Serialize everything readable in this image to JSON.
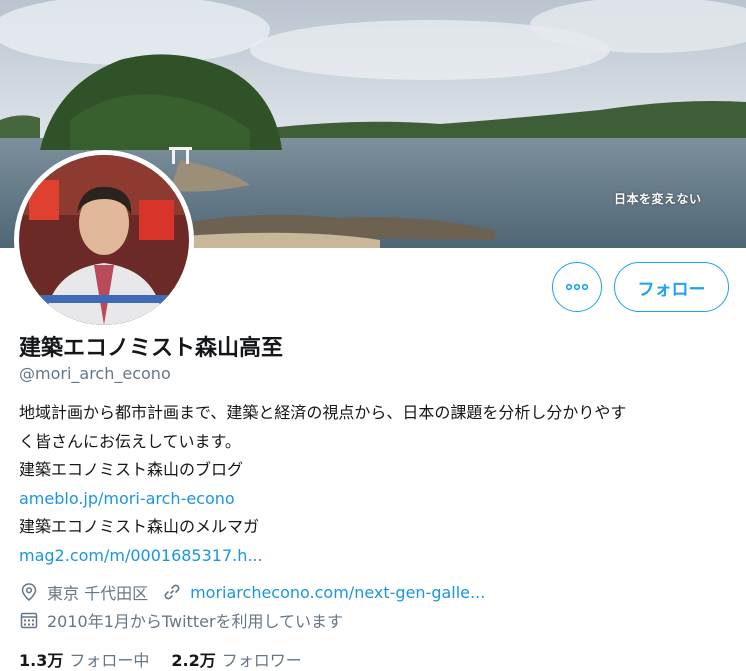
{
  "banner": {
    "caption": "日本を変えない",
    "colors": {
      "sky": "#c9d3dc",
      "water": "#5c7484",
      "island": "#2f5228"
    }
  },
  "profile": {
    "name": "建築エコノミスト森山高至",
    "handle": "@mori_arch_econo",
    "more_icon": "more-dots-icon",
    "follow_label": "フォロー"
  },
  "bio": {
    "line1": "地域計画から都市計画まで、建築と経済の視点から、日本の課題を分析し分かりやす",
    "line2": "く皆さんにお伝えしています。",
    "line3": "建築エコノミスト森山のブログ",
    "link1": "ameblo.jp/mori-arch-econo",
    "line4": "建築エコノミスト森山のメルマガ",
    "link2": "mag2.com/m/0001685317.h..."
  },
  "meta": {
    "location": "東京 千代田区",
    "location_icon": "location-pin-icon",
    "url": "moriarchecono.com/next-gen-galle...",
    "url_icon": "link-icon",
    "joined": "2010年1月からTwitterを利用しています",
    "joined_icon": "calendar-icon"
  },
  "stats": {
    "following_count": "1.3万",
    "following_label": "フォロー中",
    "followers_count": "2.2万",
    "followers_label": "フォロワー"
  },
  "accent": "#1da1f2"
}
